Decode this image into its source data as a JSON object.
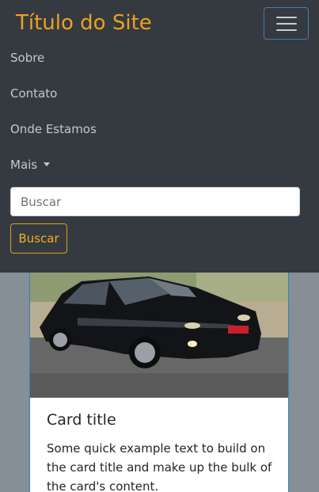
{
  "navbar": {
    "brand": "Título do Site",
    "links": [
      {
        "label": "Sobre"
      },
      {
        "label": "Contato"
      },
      {
        "label": "Onde Estamos"
      }
    ],
    "dropdown_label": "Mais",
    "search": {
      "placeholder": "Buscar",
      "button_label": "Buscar"
    }
  },
  "card": {
    "title": "Card title",
    "text": "Some quick example text to build on the card title and make up the bulk of the card's content."
  },
  "colors": {
    "navbar_bg": "#343a40",
    "brand": "#f0a020",
    "accent_warning": "#e0a010",
    "page_bg": "#868e96"
  }
}
